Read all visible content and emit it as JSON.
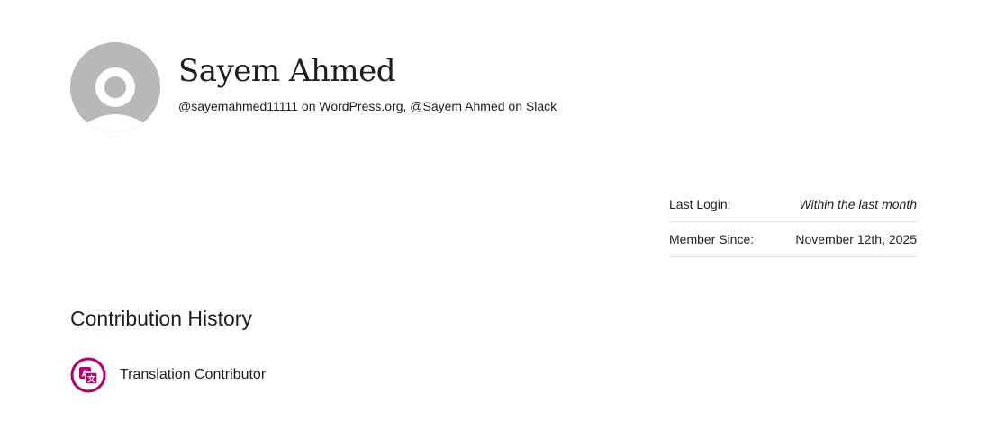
{
  "profile": {
    "display_name": "Sayem Ahmed",
    "handle_wporg": "@sayemahmed11111",
    "text_on_wporg": " on WordPress.org, ",
    "handle_slack": "@Sayem Ahmed",
    "text_on": " on ",
    "slack_link": "Slack",
    "avatar_color": "#b8b8b8"
  },
  "meta": [
    {
      "label": "Last Login:",
      "value": "Within the last month"
    },
    {
      "label": "Member Since:",
      "value": "November 12th, 2025"
    }
  ],
  "contribution_history": {
    "title": "Contribution History",
    "items": [
      {
        "label": "Translation Contributor",
        "icon": "translation-icon",
        "color": "#b5006a"
      }
    ]
  }
}
